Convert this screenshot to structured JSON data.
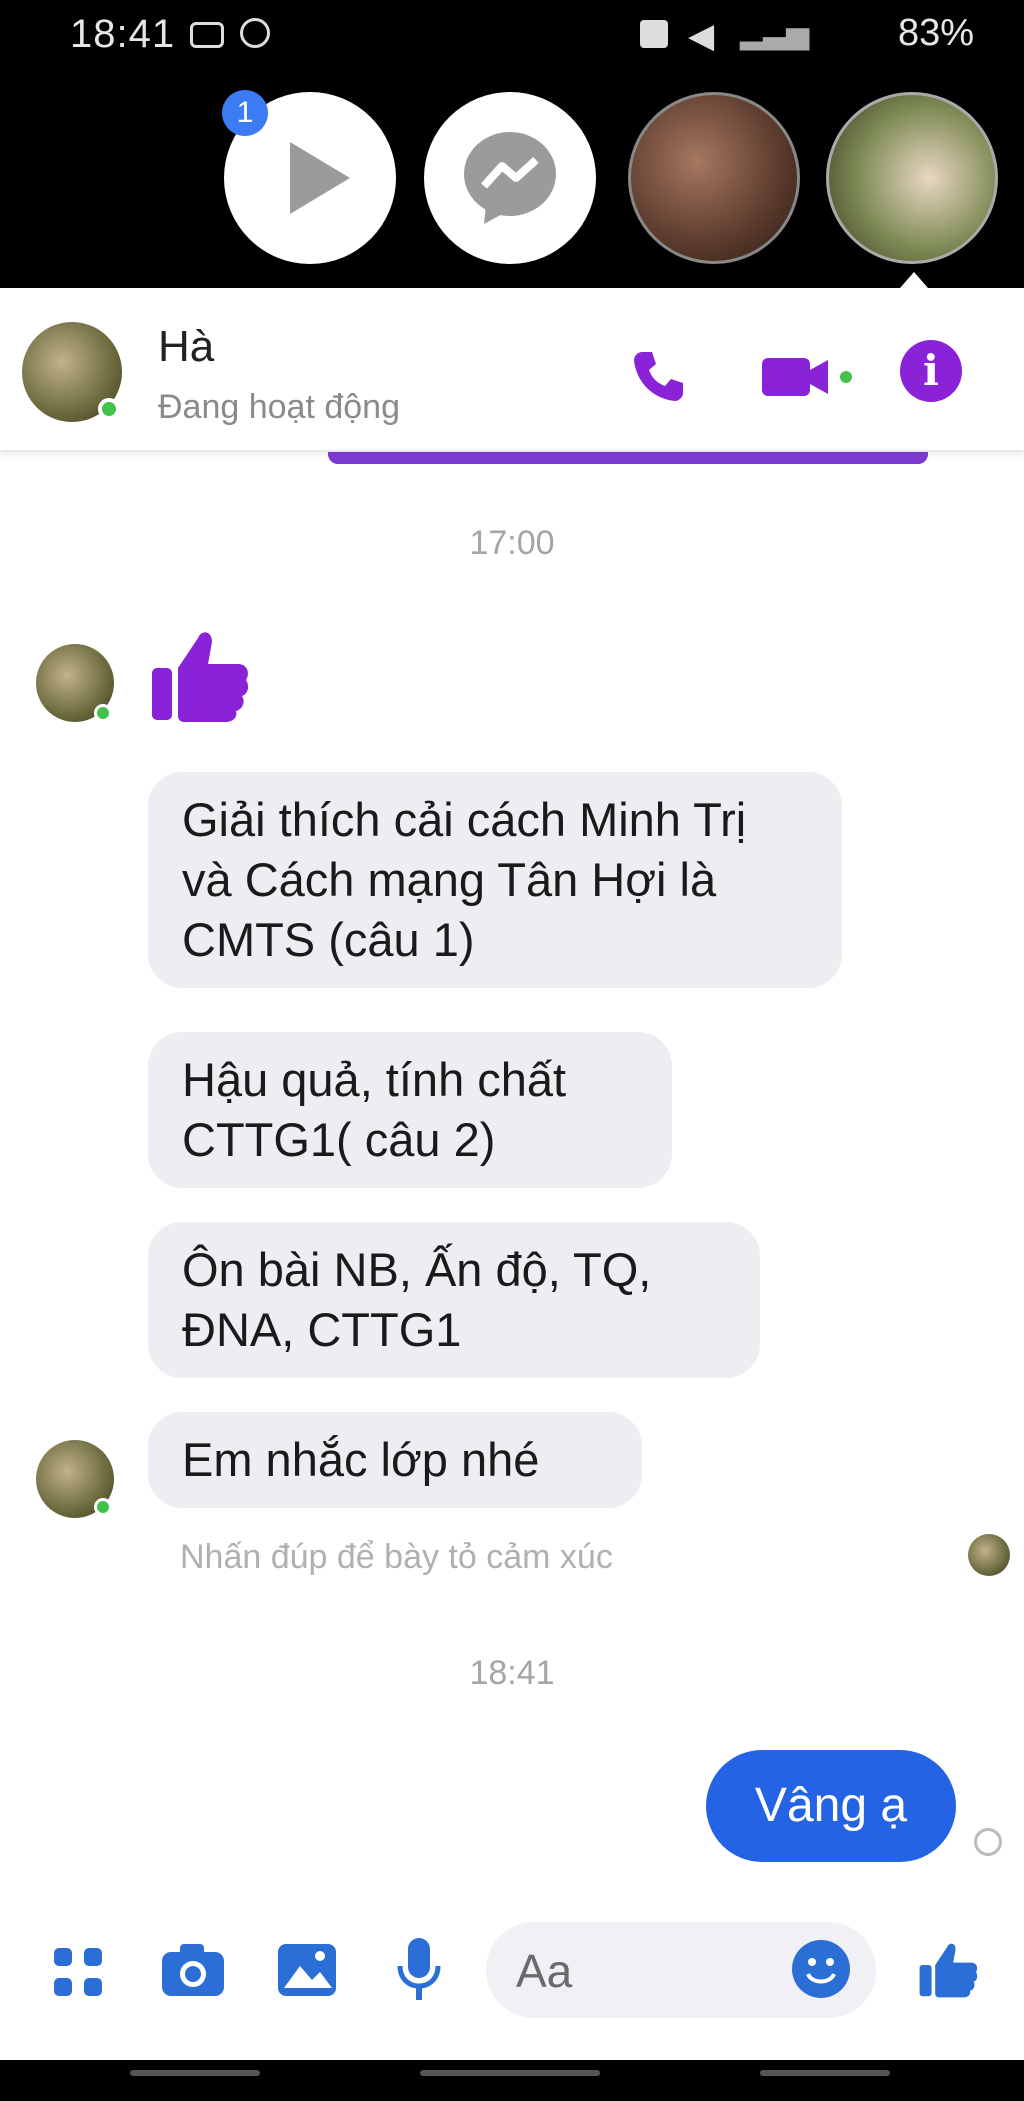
{
  "status_bar": {
    "time": "18:41",
    "battery": "83%"
  },
  "chat_heads": {
    "badge": "1"
  },
  "header": {
    "name": "Hà",
    "status": "Đang hoạt động"
  },
  "colors": {
    "accent": "#8a22d8",
    "bubble_mine": "#2463e3",
    "bubble_theirs": "#eeedf2",
    "online": "#42c24b"
  },
  "messages": {
    "stamp1": "17:00",
    "like_icon": "thumbs-up",
    "m1": "Giải thích cải cách Minh Trị và Cách mạng Tân Hợi là CMTS (câu 1)",
    "m2": "Hậu quả, tính chất CTTG1( câu 2)",
    "m3": "Ôn bài NB, Ấn độ, TQ, ĐNA, CTTG1",
    "m4": "Em nhắc lớp nhé",
    "hint": "Nhấn đúp để bày tỏ cảm xúc",
    "stamp2": "18:41",
    "reply": "Vâng ạ"
  },
  "composer": {
    "placeholder": "Aa"
  }
}
